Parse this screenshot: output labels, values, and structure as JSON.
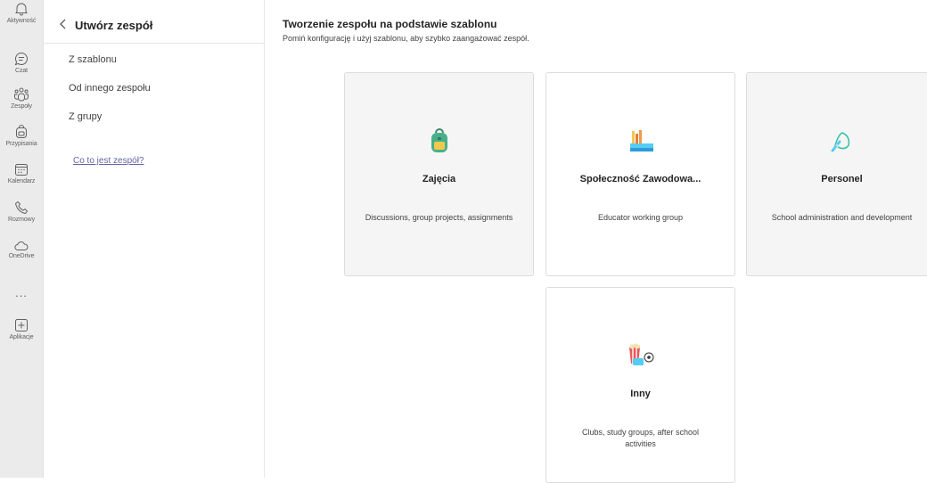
{
  "rail": {
    "items": [
      {
        "label": "Aktywność",
        "icon": "bell-icon"
      },
      {
        "label": "Czat",
        "icon": "chat-icon"
      },
      {
        "label": "Zespoły",
        "icon": "teams-icon"
      },
      {
        "label": "Przypisania",
        "icon": "backpack-icon"
      },
      {
        "label": "Kalendarz",
        "icon": "calendar-icon"
      },
      {
        "label": "Rozmowy",
        "icon": "phone-icon"
      },
      {
        "label": "OneDrive",
        "icon": "cloud-icon"
      },
      {
        "label": "Aplikacje",
        "icon": "add-apps-icon"
      }
    ],
    "more": "..."
  },
  "nav": {
    "back_icon": "chevron-left-icon",
    "title": "Utwórz zespół",
    "items": [
      "Z szablonu",
      "Od innego zespołu",
      "Z grupy"
    ],
    "link": "Co to jest zespół?"
  },
  "main": {
    "title": "Tworzenie zespołu na podstawie szablonu",
    "subtitle": "Pomiń konfigurację i użyj szablonu, aby szybko zaangażować zespół.",
    "cards": [
      {
        "title": "Zajęcia",
        "description": "Discussions, group projects, assignments",
        "icon": "green-backpack-icon"
      },
      {
        "title": "Społeczność Zawodowa...",
        "description": "Educator working group",
        "icon": "pencils-books-icon"
      },
      {
        "title": "Personel",
        "description": "School administration and development",
        "icon": "apple-ribbon-icon"
      },
      {
        "title": "Inny",
        "description": "Clubs, study groups, after school activities",
        "icon": "popcorn-ball-icon"
      }
    ]
  },
  "colors": {
    "accent": "#6264a7",
    "rail_bg": "#ebebeb",
    "card_tint": "#f5f5f5"
  }
}
